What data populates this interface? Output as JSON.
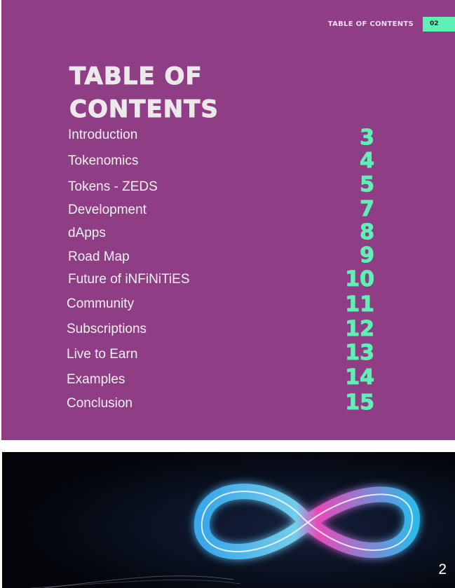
{
  "header": {
    "section_label": "TABLE OF CONTENTS",
    "page_badge": "02"
  },
  "title": {
    "line1": "TABLE OF",
    "line2": "CONTENTS"
  },
  "entries": [
    {
      "label": "Introduction",
      "page": "3"
    },
    {
      "label": "Tokenomics",
      "page": "4"
    },
    {
      "label": "Tokens - ZEDS",
      "page": "5"
    },
    {
      "label": "Development",
      "page": "7"
    },
    {
      "label": "dApps",
      "page": "8"
    },
    {
      "label": "Road Map",
      "page": "9"
    },
    {
      "label": "Future of iNFiNiTiES",
      "page": "10"
    },
    {
      "label": "Community",
      "page": "11"
    },
    {
      "label": "Subscriptions",
      "page": "12"
    },
    {
      "label": "Live to Earn",
      "page": "13"
    },
    {
      "label": "Examples",
      "page": "14"
    },
    {
      "label": "Conclusion",
      "page": "15"
    }
  ],
  "footer": {
    "page_number": "2",
    "image_icon": "infinity-icon"
  },
  "colors": {
    "panel": "#8f3d85",
    "accent": "#5ff0b5",
    "cover_bg": "#03050b"
  }
}
